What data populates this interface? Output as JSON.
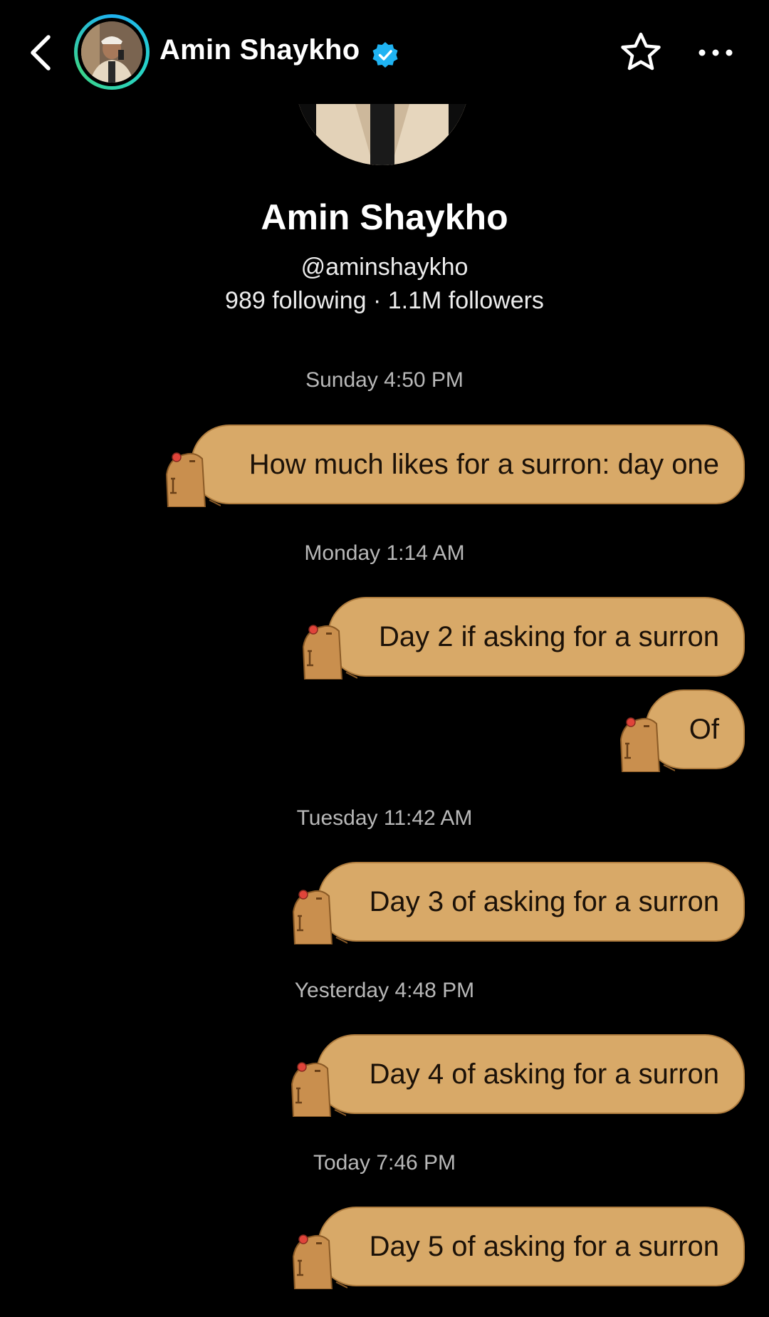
{
  "header": {
    "name": "Amin Shaykho",
    "back_icon": "chevron-left-icon",
    "verified_icon": "verified-badge-icon",
    "star_icon": "star-outline-icon",
    "more_icon": "more-horizontal-icon"
  },
  "profile": {
    "name": "Amin Shaykho",
    "handle": "@aminshaykho",
    "stats": "989 following · 1.1M followers"
  },
  "colors": {
    "background": "#000000",
    "bubble": "#d8a968",
    "bubble_text": "#1b1108",
    "verified": "#1fb3f2",
    "timestamp": "#b8b8b8"
  },
  "conversation": [
    {
      "timestamp": "Sunday 4:50 PM"
    },
    {
      "message": "How much likes for a surron: day one"
    },
    {
      "timestamp": "Monday 1:14 AM"
    },
    {
      "message": "Day 2 if asking for a surron"
    },
    {
      "message": "Of"
    },
    {
      "timestamp": "Tuesday 11:42 AM"
    },
    {
      "message": "Day 3 of asking for a surron"
    },
    {
      "timestamp": "Yesterday 4:48 PM"
    },
    {
      "message": "Day 4 of asking for a surron"
    },
    {
      "timestamp": "Today 7:46 PM"
    },
    {
      "message": "Day 5 of asking for a surron"
    }
  ]
}
